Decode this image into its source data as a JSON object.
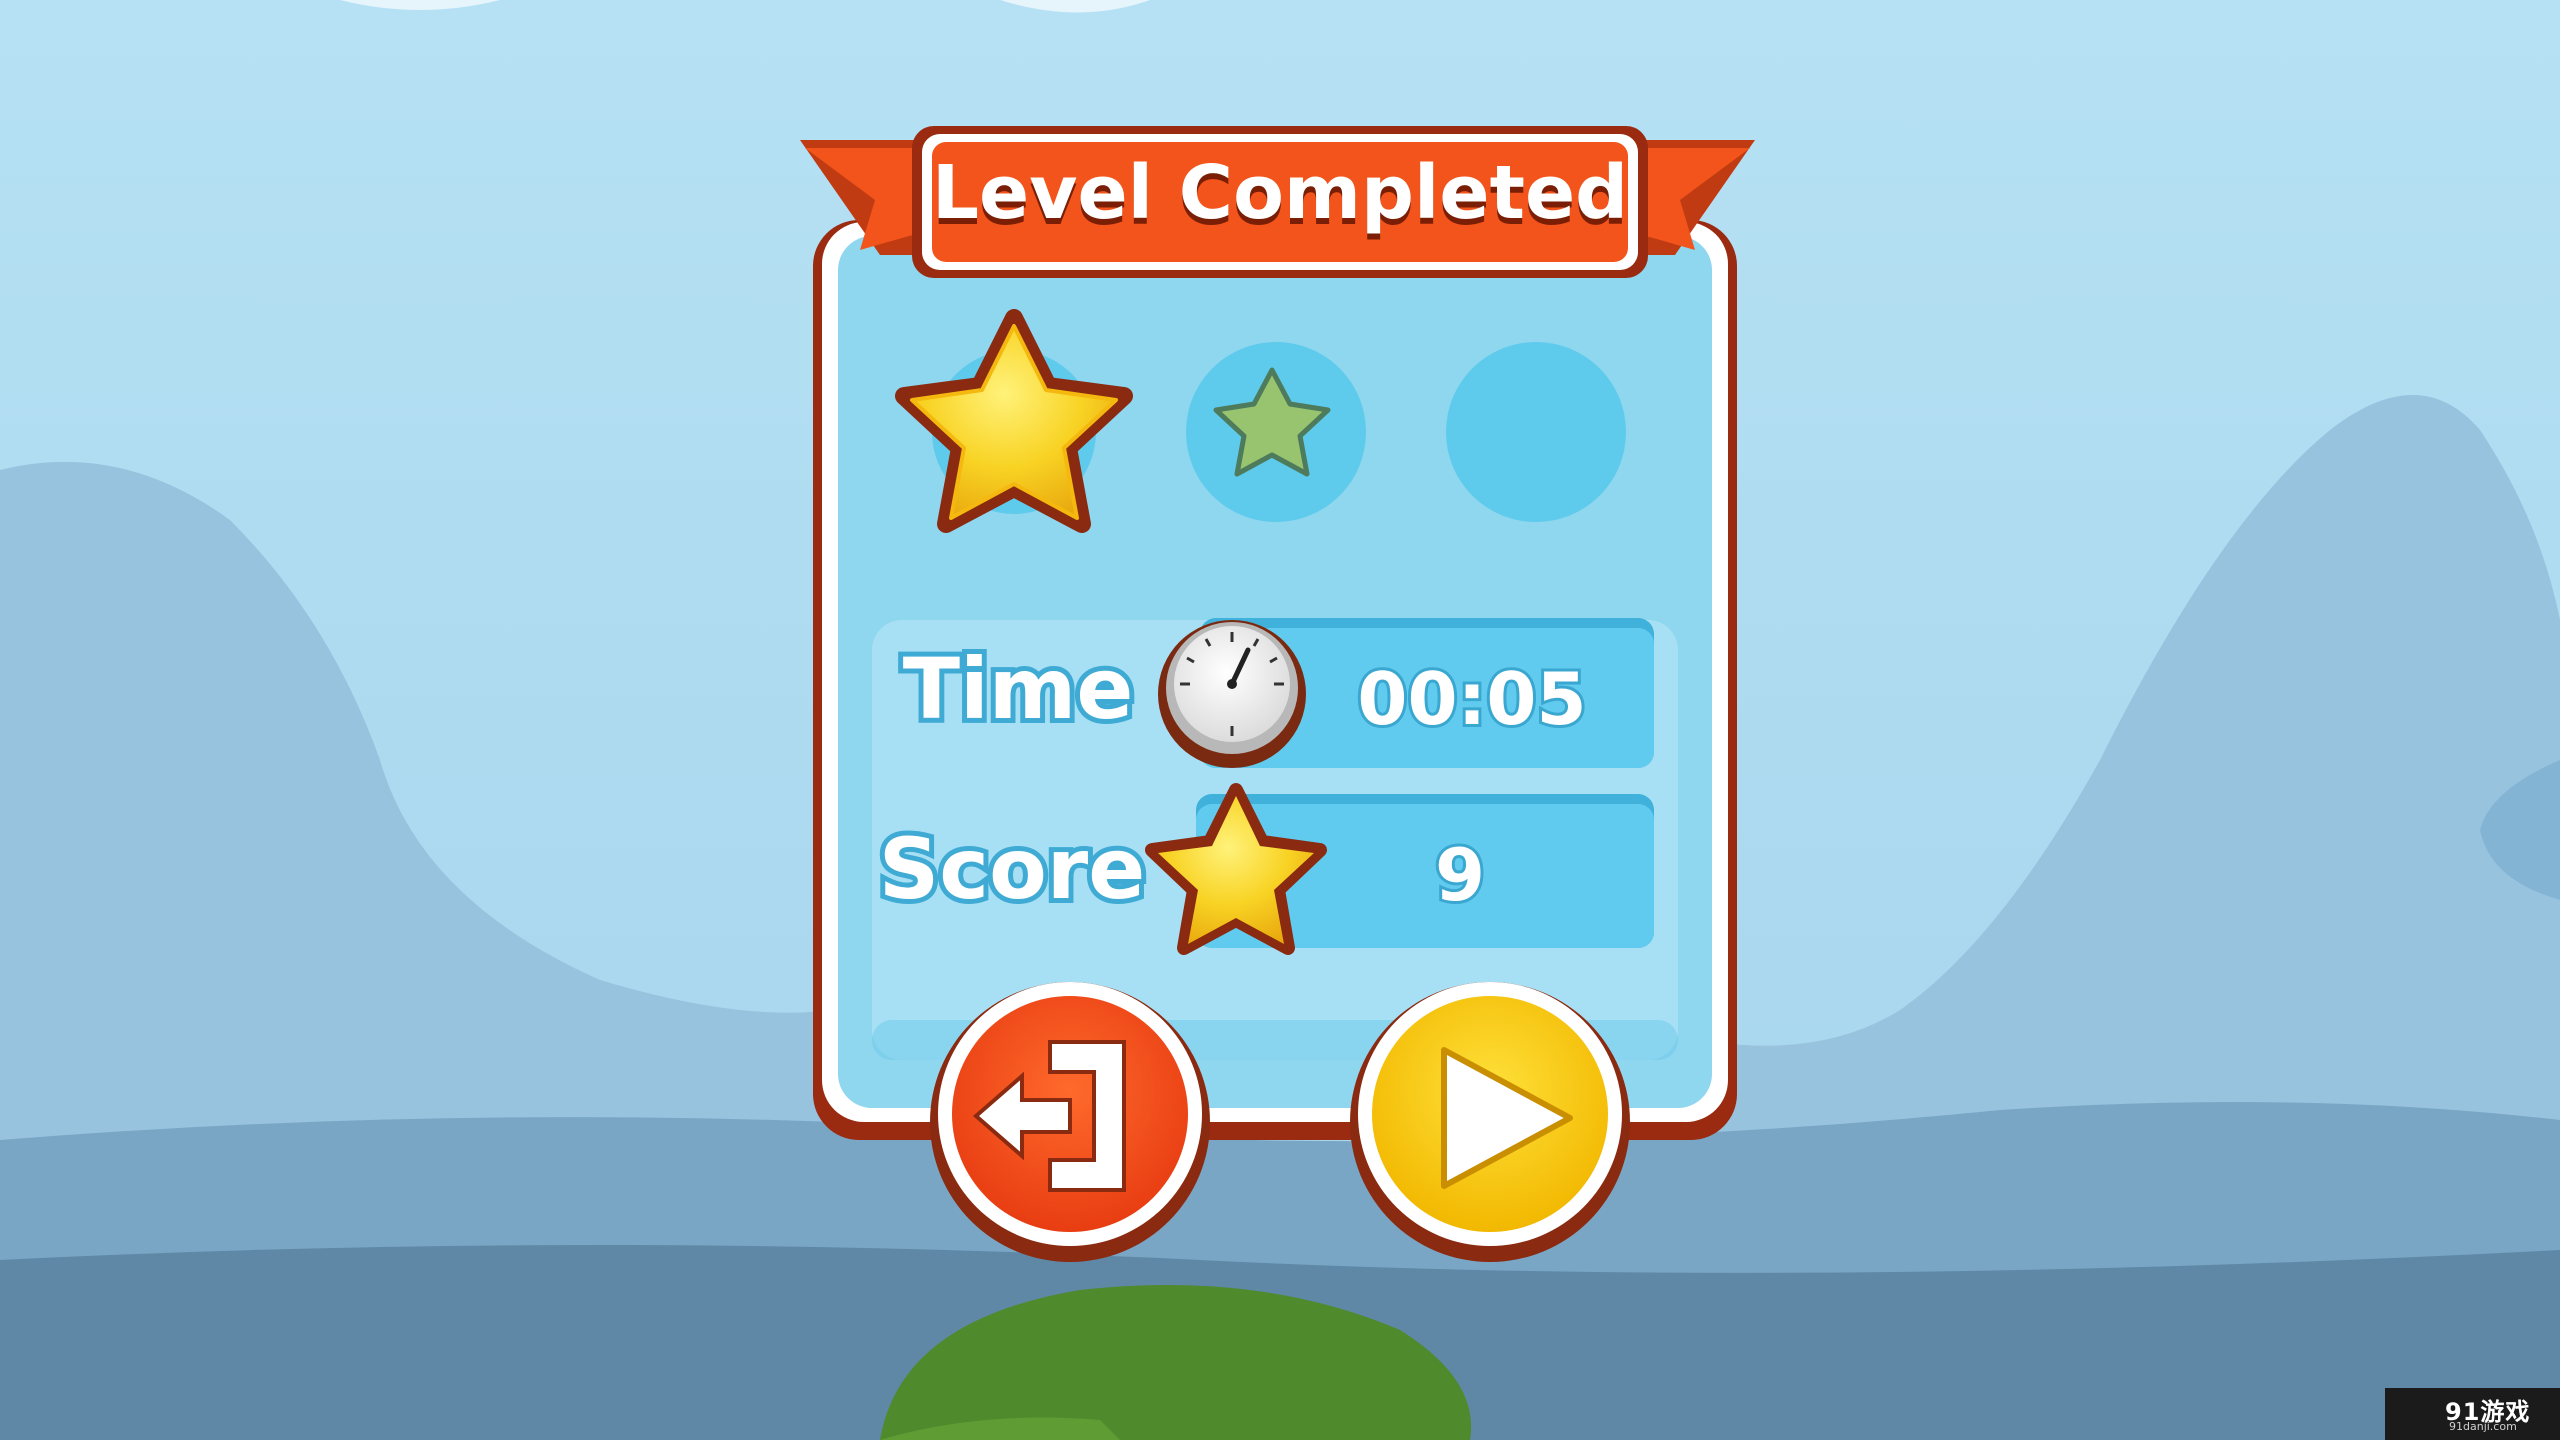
{
  "dialog": {
    "title": "Level Completed",
    "stars_earned": 1,
    "stars_total": 3,
    "time_label": "Time",
    "time_value": "00:05",
    "score_label": "Score",
    "score_value": "9"
  },
  "buttons": {
    "exit": {
      "icon": "exit-door-icon"
    },
    "next": {
      "icon": "play-icon"
    }
  },
  "watermark": {
    "main": "91游戏",
    "sub": "91danji.com"
  },
  "colors": {
    "sky": "#aedcf2",
    "ribbon": "#f2541b",
    "panel_blue": "#8fd6ef",
    "star_gold": "#f8d324",
    "play_yellow": "#f5c800",
    "exit_red": "#f04a1c"
  }
}
